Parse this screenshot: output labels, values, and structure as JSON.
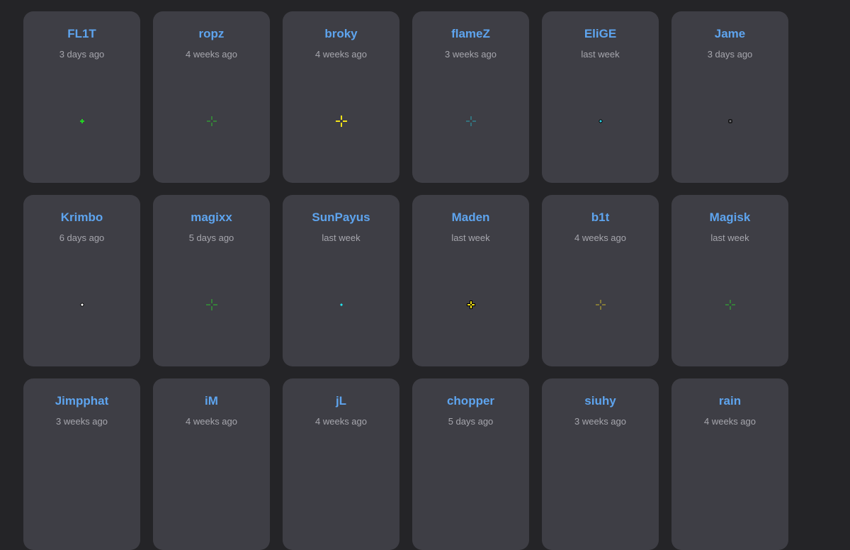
{
  "players": [
    {
      "name": "FL1T",
      "updated": "3 days ago",
      "crosshair": {
        "style": "cross",
        "color": "#22d622",
        "size": 3,
        "gap": 0,
        "thickness": 2,
        "dot": true,
        "outline": false
      }
    },
    {
      "name": "ropz",
      "updated": "4 weeks ago",
      "crosshair": {
        "style": "cross",
        "color": "#2fc22f",
        "size": 5,
        "gap": 2,
        "thickness": 1,
        "dot": false,
        "outline": false
      }
    },
    {
      "name": "broky",
      "updated": "4 weeks ago",
      "crosshair": {
        "style": "cross",
        "color": "#f2e21a",
        "size": 6,
        "gap": 2,
        "thickness": 2,
        "dot": false,
        "outline": false
      }
    },
    {
      "name": "flameZ",
      "updated": "3 weeks ago",
      "crosshair": {
        "style": "cross",
        "color": "#2aa7b5",
        "size": 5,
        "gap": 2,
        "thickness": 1,
        "dot": false,
        "outline": false
      }
    },
    {
      "name": "EliGE",
      "updated": "last week",
      "crosshair": {
        "style": "dot",
        "color": "#2fd3e6",
        "size": 2,
        "gap": 0,
        "thickness": 2,
        "dot": true,
        "outline": true
      }
    },
    {
      "name": "Jame",
      "updated": "3 days ago",
      "crosshair": {
        "style": "circle",
        "color": "#111111",
        "size": 3,
        "gap": 0,
        "thickness": 1,
        "dot": true,
        "outline": true
      }
    },
    {
      "name": "Krimbo",
      "updated": "6 days ago",
      "crosshair": {
        "style": "dot",
        "color": "#ffffff",
        "size": 2,
        "gap": 0,
        "thickness": 2,
        "dot": true,
        "outline": true
      }
    },
    {
      "name": "magixx",
      "updated": "5 days ago",
      "crosshair": {
        "style": "cross",
        "color": "#2fc22f",
        "size": 6,
        "gap": 2,
        "thickness": 1,
        "dot": false,
        "outline": false
      }
    },
    {
      "name": "SunPayus",
      "updated": "last week",
      "crosshair": {
        "style": "dot",
        "color": "#22e6ee",
        "size": 2,
        "gap": 0,
        "thickness": 3,
        "dot": true,
        "outline": false
      }
    },
    {
      "name": "Maden",
      "updated": "last week",
      "crosshair": {
        "style": "cross",
        "color": "#f2e21a",
        "size": 4,
        "gap": 1,
        "thickness": 2,
        "dot": false,
        "outline": true
      }
    },
    {
      "name": "b1t",
      "updated": "4 weeks ago",
      "crosshair": {
        "style": "cross",
        "color": "#c9b52a",
        "size": 5,
        "gap": 2,
        "thickness": 1,
        "dot": false,
        "outline": false
      }
    },
    {
      "name": "Magisk",
      "updated": "last week",
      "crosshair": {
        "style": "cross",
        "color": "#2fc22f",
        "size": 5,
        "gap": 2,
        "thickness": 1,
        "dot": false,
        "outline": false
      }
    },
    {
      "name": "Jimpphat",
      "updated": "3 weeks ago",
      "crosshair": null
    },
    {
      "name": "iM",
      "updated": "4 weeks ago",
      "crosshair": null
    },
    {
      "name": "jL",
      "updated": "4 weeks ago",
      "crosshair": null
    },
    {
      "name": "chopper",
      "updated": "5 days ago",
      "crosshair": null
    },
    {
      "name": "siuhy",
      "updated": "3 weeks ago",
      "crosshair": null
    },
    {
      "name": "rain",
      "updated": "4 weeks ago",
      "crosshair": null
    }
  ]
}
